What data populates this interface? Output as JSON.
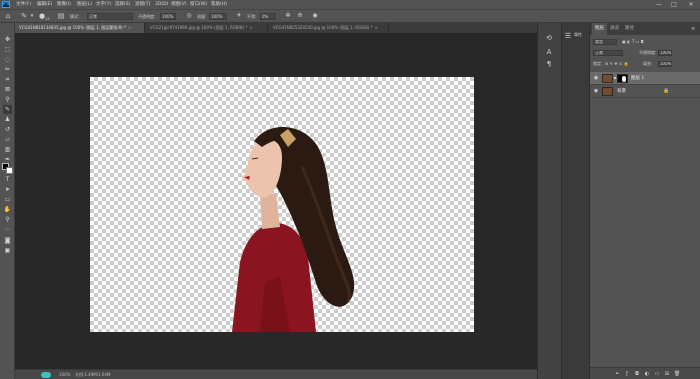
{
  "app": {
    "logo": "Ps"
  },
  "menu": [
    "文件(F)",
    "编辑(E)",
    "图像(I)",
    "图层(L)",
    "文字(Y)",
    "选择(S)",
    "滤镜(T)",
    "3D(D)",
    "视图(V)",
    "窗口(W)",
    "帮助(H)"
  ],
  "window_controls": [
    "—",
    "□",
    "✕"
  ],
  "options": {
    "brush_size": "13",
    "mode_label": "模式:",
    "mode_value": "正常",
    "opacity_label": "不透明度:",
    "opacity_value": "100%",
    "flow_label": "流量:",
    "flow_value": "100%",
    "smooth_label": "平滑:",
    "smooth_value": "0%"
  },
  "tabs": [
    {
      "label": "VCG41N818134835.jpg @ 100% (图层 1, 图层蒙版/8) *",
      "active": true
    },
    {
      "label": "VCG21gic9741969.jpg @ 100% (图层 1, RGB/8) *",
      "active": false
    },
    {
      "label": "VCG41N825324540.jpg @ 100% (图层 1, RGB/8) *",
      "active": false
    }
  ],
  "status": {
    "zoom": "100%",
    "doc": "文档:1.49M/1.64M"
  },
  "dock": {
    "history_label": "属性"
  },
  "layers_panel": {
    "tabs": [
      "图层",
      "通道",
      "路径"
    ],
    "filter_kind": "类型",
    "blend_mode": "正常",
    "opacity_label": "不透明度:",
    "opacity_value": "100%",
    "lock_label": "锁定:",
    "fill_label": "填充:",
    "fill_value": "100%",
    "layers": [
      {
        "name": "图层 1",
        "selected": true,
        "locked": false
      },
      {
        "name": "背景",
        "selected": false,
        "locked": true
      }
    ]
  },
  "colors": {
    "foreground": "#000000",
    "background": "#ffffff",
    "sweater": "#8a1520",
    "hair": "#2a1a12"
  }
}
